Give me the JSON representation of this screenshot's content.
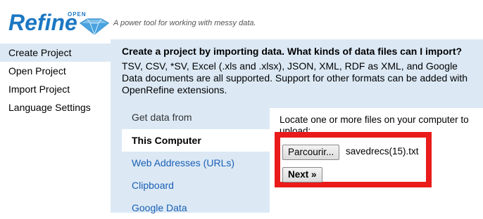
{
  "header": {
    "logo_text": "Refine",
    "logo_superscript": "OPEN",
    "tagline": "A power tool for working with messy data.",
    "logo_color": "#1c77c3"
  },
  "nav": {
    "items": [
      {
        "label": "Create Project",
        "active": true
      },
      {
        "label": "Open Project",
        "active": false
      },
      {
        "label": "Import Project",
        "active": false
      },
      {
        "label": "Language Settings",
        "active": false
      }
    ]
  },
  "main": {
    "title": "Create a project by importing data. What kinds of data files can I import?",
    "description": "TSV, CSV, *SV, Excel (.xls and .xlsx), JSON, XML, RDF as XML, and Google Data documents are all supported. Support for other formats can be added with OpenRefine extensions.",
    "tabs_heading": "Get data from",
    "tabs": [
      {
        "label": "This Computer",
        "active": true
      },
      {
        "label": "Web Addresses (URLs)",
        "active": false
      },
      {
        "label": "Clipboard",
        "active": false
      },
      {
        "label": "Google Data",
        "active": false
      }
    ]
  },
  "upload": {
    "instruction": "Locate one or more files on your computer to upload:",
    "browse_label": "Parcourir...",
    "filename": "savedrecs(15).txt",
    "next_label": "Next »",
    "highlight_color": "#ea1b1b"
  },
  "colors": {
    "panel_bg": "#dce9f5",
    "link": "#1a5fb4"
  }
}
